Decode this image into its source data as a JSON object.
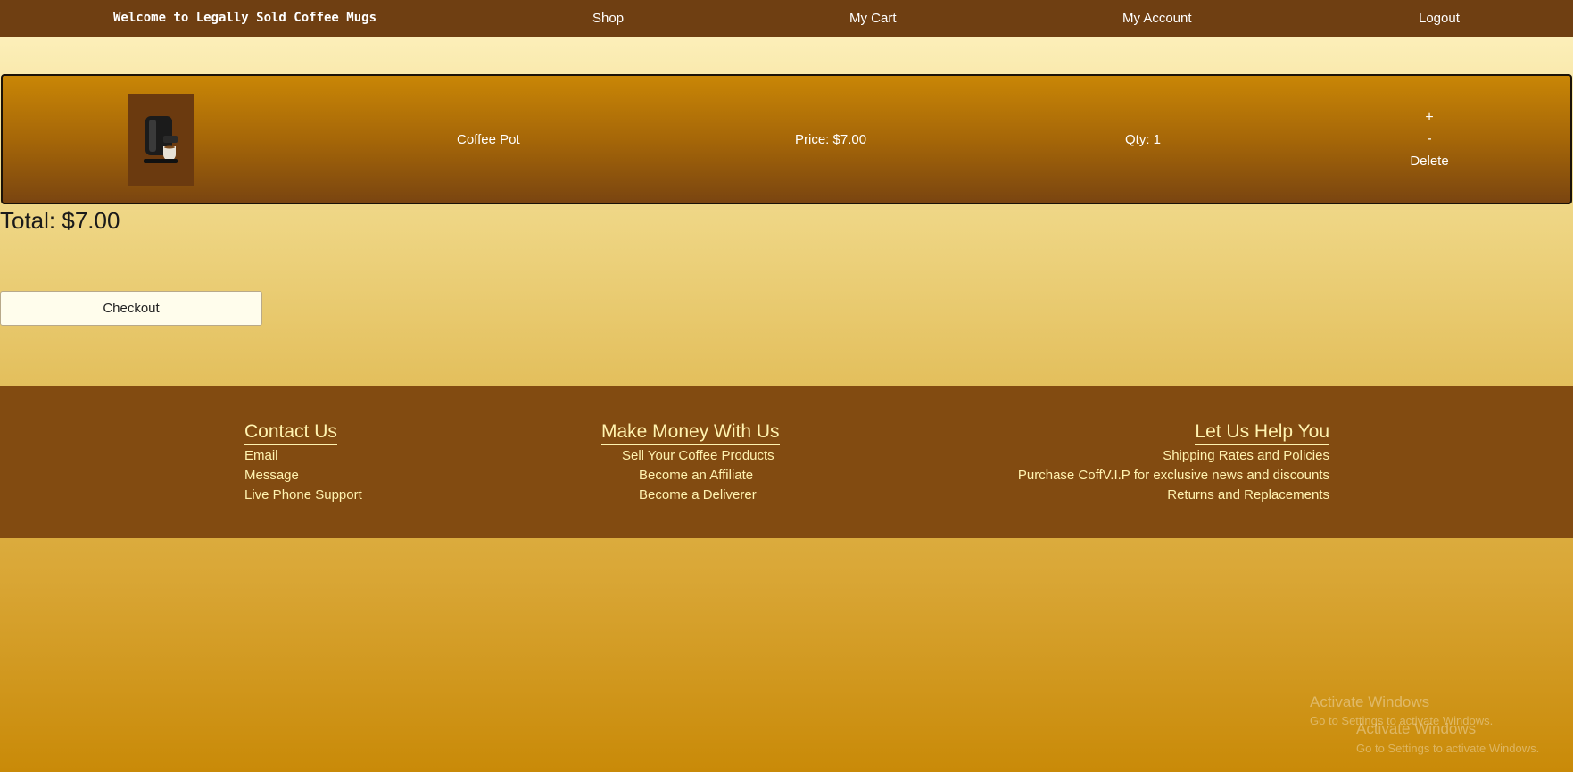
{
  "nav": {
    "brand": "Welcome to Legally Sold Coffee Mugs",
    "shop": "Shop",
    "cart": "My Cart",
    "account": "My Account",
    "logout": "Logout"
  },
  "cart": {
    "items": [
      {
        "name": "Coffee Pot",
        "price": "Price: $7.00",
        "qty": "Qty: 1",
        "plus": "+",
        "minus": "-",
        "delete": "Delete"
      }
    ],
    "total": "Total: $7.00",
    "checkout": "Checkout"
  },
  "footer": {
    "contact": {
      "heading": "Contact Us",
      "links": [
        "Email",
        "Message",
        "Live Phone Support"
      ]
    },
    "money": {
      "heading": "Make Money With Us",
      "links": [
        "Sell Your Coffee Products",
        "Become an Affiliate",
        "Become a Deliverer"
      ]
    },
    "help": {
      "heading": "Let Us Help You",
      "links": [
        "Shipping Rates and Policies",
        "Purchase CoffV.I.P for exclusive news and discounts",
        "Returns and Replacements"
      ]
    }
  },
  "watermark": {
    "title": "Activate Windows",
    "subtitle": "Go to Settings to activate Windows."
  },
  "colors": {
    "nav_bg": "#6f3f12",
    "footer_bg": "#824b11",
    "footer_text": "#fff3b0"
  }
}
